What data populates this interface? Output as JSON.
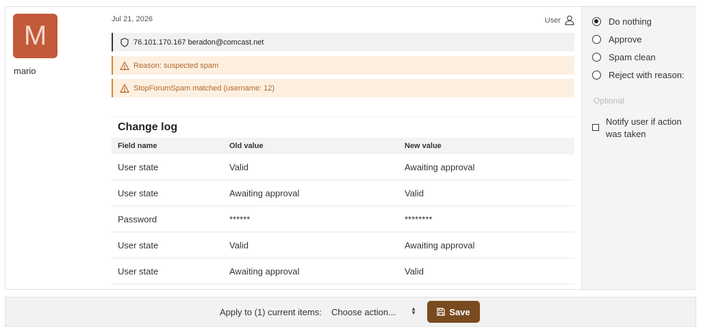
{
  "user": {
    "avatar_letter": "M",
    "avatar_color": "#c35a3a",
    "username": "mario"
  },
  "meta": {
    "date": "Jul 21, 2026",
    "role_label": "User",
    "role_icon": "user-icon"
  },
  "info_bars": {
    "ip_email": "76.101.170.167 beradon@comcast.net",
    "reason": "Reason: suspected spam",
    "stopforumspam": "StopForumSpam matched (username: 12)"
  },
  "changelog": {
    "title": "Change log",
    "columns": [
      "Field name",
      "Old value",
      "New value"
    ],
    "rows": [
      [
        "User state",
        "Valid",
        "Awaiting approval"
      ],
      [
        "User state",
        "Awaiting approval",
        "Valid"
      ],
      [
        "Password",
        "******",
        "********"
      ],
      [
        "User state",
        "Valid",
        "Awaiting approval"
      ],
      [
        "User state",
        "Awaiting approval",
        "Valid"
      ]
    ]
  },
  "actions": {
    "options": [
      "Do nothing",
      "Approve",
      "Spam clean",
      "Reject with reason:"
    ],
    "selected": "Do nothing",
    "reason_placeholder": "Optional",
    "notify_label": "Notify user if action was taken"
  },
  "footer": {
    "apply_label": "Apply to (1) current items:",
    "select_value": "Choose action...",
    "save_label": "Save"
  },
  "colors": {
    "accent": "#7a4a1f",
    "warning_bg": "#fdf0e1",
    "warning_text": "#b0672a"
  }
}
